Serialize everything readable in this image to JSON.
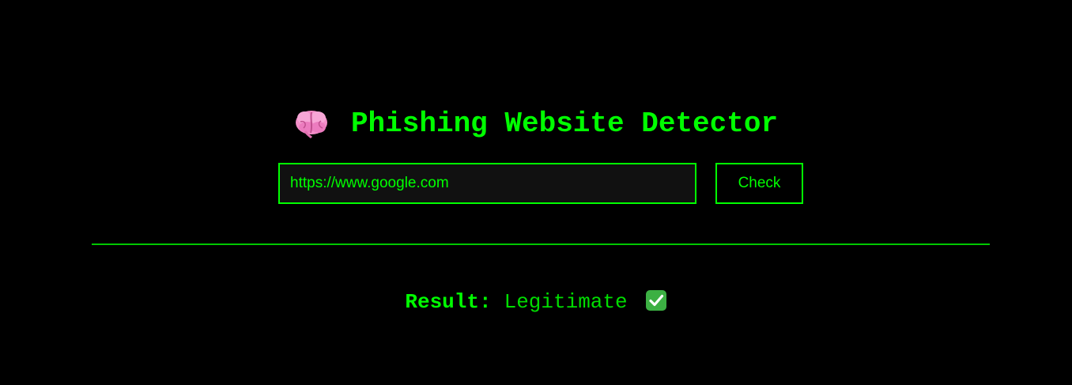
{
  "header": {
    "icon": "brain-icon",
    "title": "Phishing Website Detector"
  },
  "form": {
    "url_value": "https://www.google.com",
    "check_label": "Check"
  },
  "result": {
    "label": "Result:",
    "value": "Legitimate",
    "icon": "check-mark-icon"
  },
  "colors": {
    "background": "#000000",
    "accent": "#00ff00",
    "input_background": "#111111",
    "check_icon": "#3cb043",
    "brain_icon": "#f48fc9"
  }
}
